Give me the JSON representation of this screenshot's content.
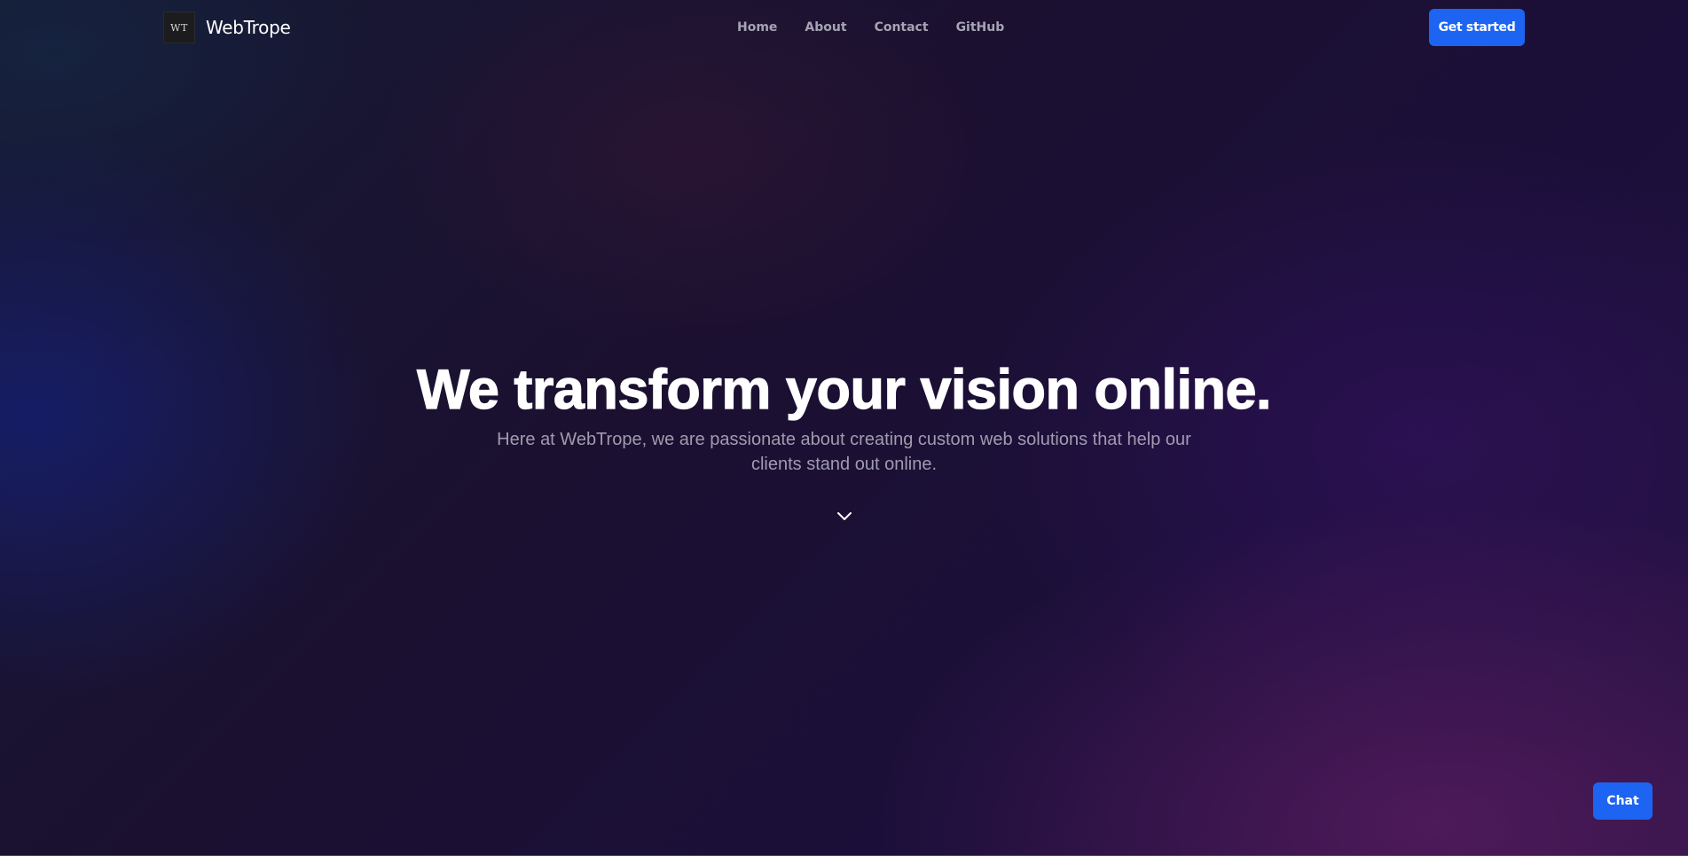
{
  "header": {
    "logo_mark": "WT",
    "brand_name": "WebTrope",
    "nav": [
      {
        "label": "Home"
      },
      {
        "label": "About"
      },
      {
        "label": "Contact"
      },
      {
        "label": "GitHub"
      }
    ],
    "cta_label": "Get started"
  },
  "hero": {
    "title": "We transform your vision online.",
    "subtitle": "Here at WebTrope, we are passionate about creating custom web solutions that help our clients stand out online.",
    "scroll_icon": "chevron-down-icon"
  },
  "chat": {
    "label": "Chat"
  },
  "colors": {
    "accent": "#1d64f2",
    "nav_text": "#a6a3b3",
    "subtitle_text": "#a09caf",
    "background_dark": "#140d26"
  }
}
